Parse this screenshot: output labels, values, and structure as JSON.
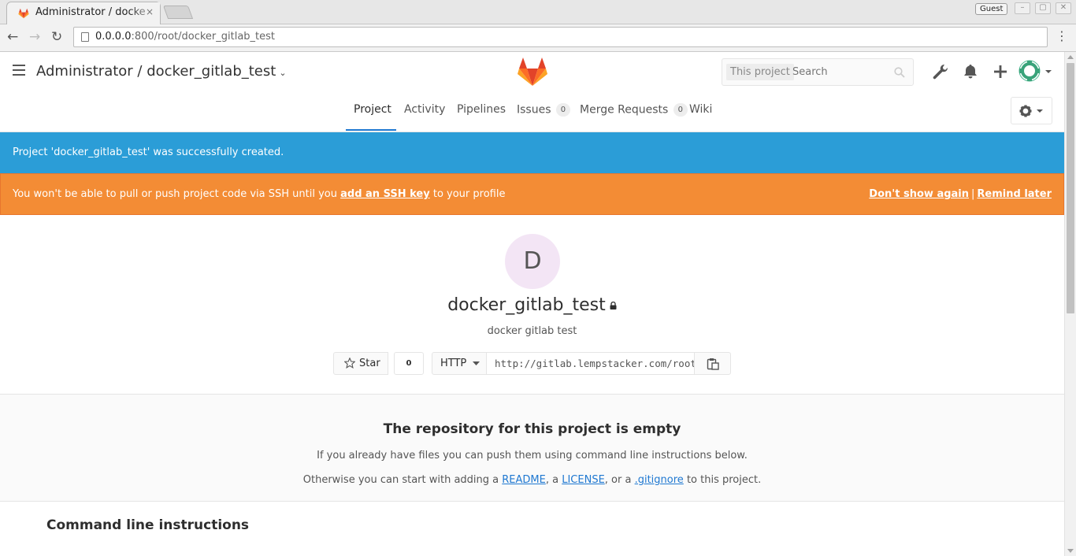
{
  "browser": {
    "tab_title": "Administrator / docker_gitlab_test",
    "tab_close": "×",
    "profile_label": "Guest",
    "window_controls": {
      "minimize": "–",
      "maximize": "▢",
      "close": "✕"
    },
    "nav": {
      "back": "←",
      "forward": "→",
      "reload": "↻",
      "menu": "⋮"
    },
    "url_host": "0.0.0.0",
    "url_rest": ":800/root/docker_gitlab_test"
  },
  "header": {
    "breadcrumb": "Administrator / docker_gitlab_test",
    "caret": "⌄",
    "search_scope": "This project",
    "search_placeholder": "Search",
    "icons": [
      "admin-wrench-icon",
      "notifications-bell-icon",
      "new-plus-icon",
      "user-avatar"
    ],
    "brand_color": "#e24329"
  },
  "subnav": {
    "items": [
      {
        "label": "Project"
      },
      {
        "label": "Activity"
      },
      {
        "label": "Pipelines"
      },
      {
        "label": "Issues",
        "count": "0"
      },
      {
        "label": "Merge Requests",
        "count": "0"
      },
      {
        "label": "Wiki"
      }
    ],
    "active": "Project",
    "settings_caret": "▾"
  },
  "flash": {
    "notice": "Project 'docker_gitlab_test' was successfully created.",
    "notice_color": "#2b9dd7",
    "warning_pre": "You won't be able to pull or push project code via SSH until you ",
    "warning_link": "add an SSH key",
    "warning_post": " to your profile",
    "warning_color": "#f38c35",
    "dont_show": "Don't show again",
    "separator": "|",
    "remind_later": "Remind later"
  },
  "project": {
    "avatar_letter": "D",
    "name": "docker_gitlab_test",
    "description": "docker gitlab test",
    "star_label": "Star",
    "star_count": "0",
    "clone_protocol": "HTTP",
    "clone_url": "http://gitlab.lempstacker.com/root/docker_gitlab_test.git"
  },
  "empty_repo": {
    "title": "The repository for this project is empty",
    "line1": "If you already have files you can push them using command line instructions below.",
    "line2_pre": "Otherwise you can start with adding a ",
    "readme": "README",
    "comma1": ", a ",
    "license": "LICENSE",
    "comma2": ", or a ",
    "gitignore": ".gitignore",
    "line2_post": " to this project."
  },
  "cli": {
    "title": "Command line instructions"
  }
}
